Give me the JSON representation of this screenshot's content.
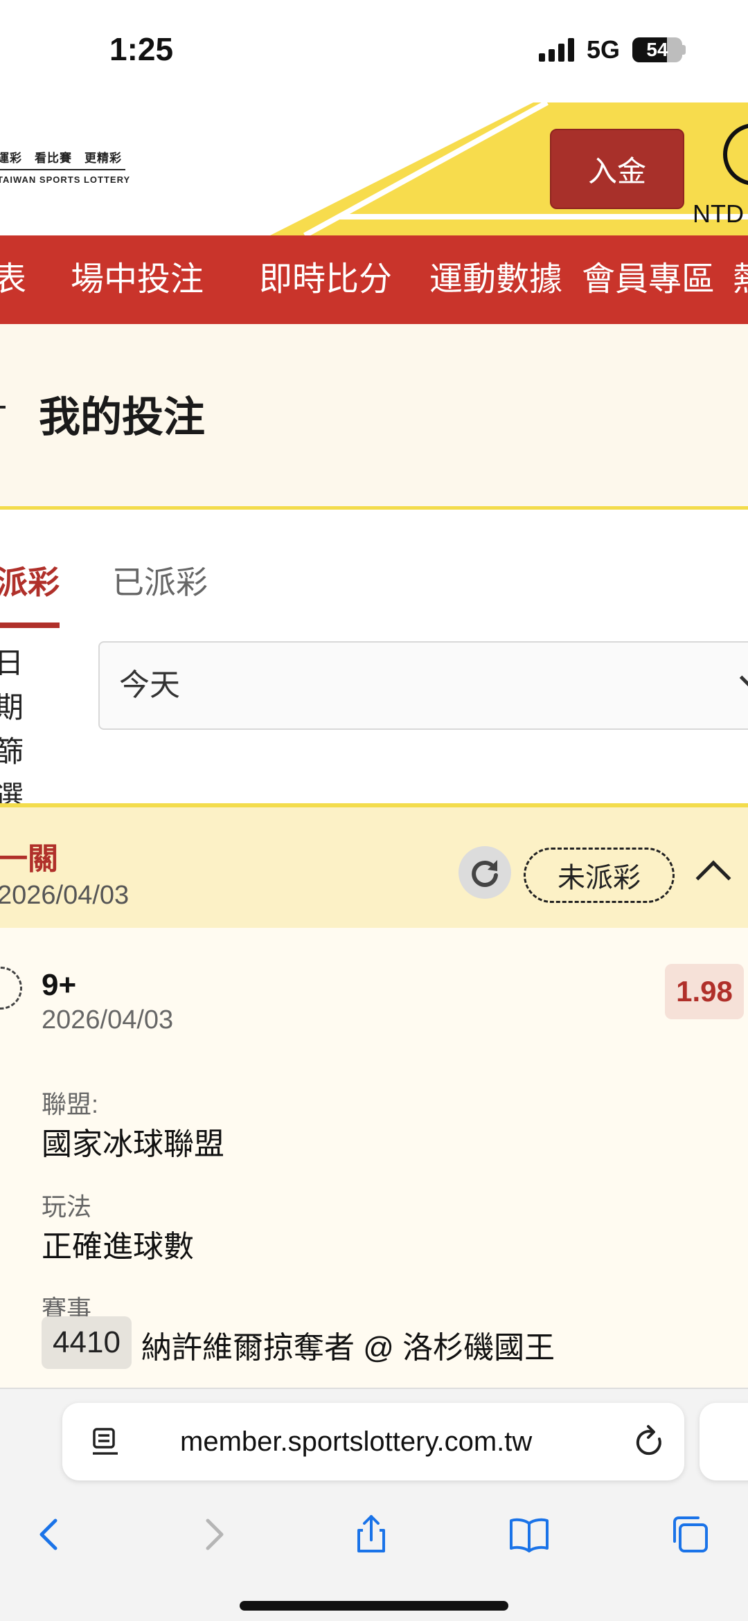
{
  "status_bar": {
    "time": "1:25",
    "network": "5G",
    "battery": "54"
  },
  "header": {
    "logo_cn": "運彩　看比賽　更精彩",
    "logo_en": "TAIWAN SPORTS LOTTERY",
    "deposit_label": "入金",
    "currency": "NTD"
  },
  "nav": {
    "items": [
      "表",
      "場中投注",
      "即時比分",
      "運動數據",
      "會員專區",
      "熱"
    ]
  },
  "page": {
    "title": "我的投注"
  },
  "tabs": {
    "active": "派彩",
    "inactive": "已派彩"
  },
  "filter": {
    "label": "日期篩選",
    "value": "今天"
  },
  "bet": {
    "type": "一關",
    "date": "2026/04/03",
    "status": "未派彩",
    "selection": "9+",
    "selection_date": "2026/04/03",
    "odds": "1.98",
    "league_label": "聯盟:",
    "league": "國家冰球聯盟",
    "play_label": "玩法",
    "play": "正確進球數",
    "event_label": "賽事",
    "event_code": "4410",
    "event_name": "納許維爾掠奪者 @ 洛杉磯國王"
  },
  "browser": {
    "url": "member.sportslottery.com.tw"
  },
  "colors": {
    "brand_red": "#c9342b",
    "accent_yellow": "#f3dc4c",
    "odds_red": "#b0302a"
  }
}
